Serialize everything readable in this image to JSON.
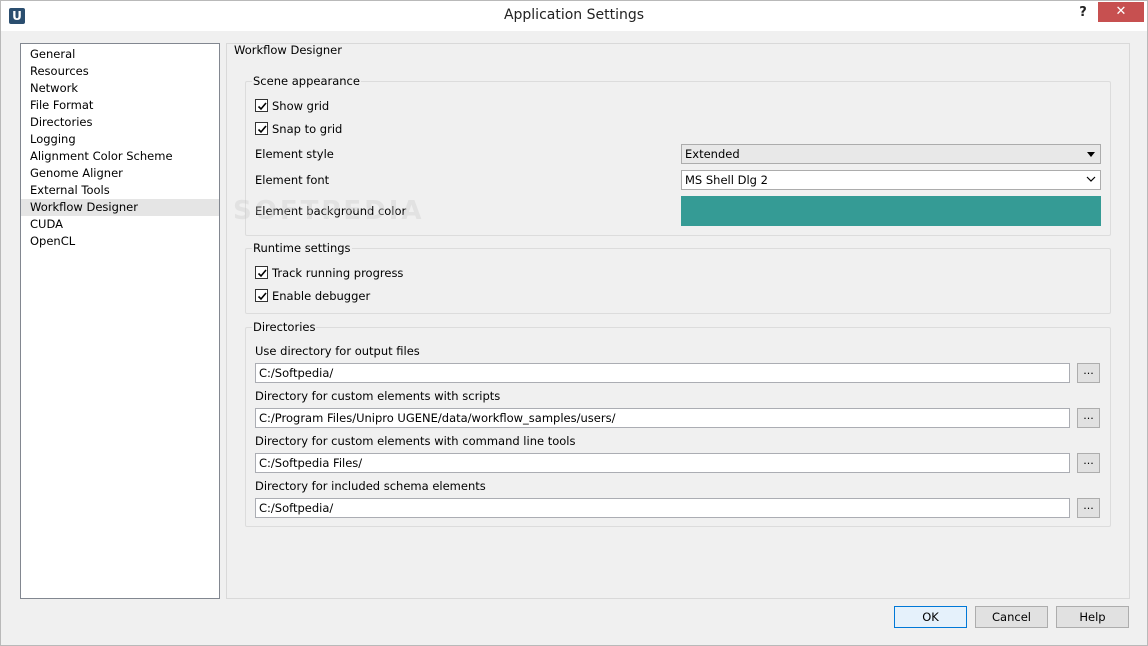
{
  "window": {
    "title": "Application Settings",
    "app_icon": "U",
    "help_label": "?",
    "close_label": "✕"
  },
  "nav": {
    "items": [
      {
        "label": "General"
      },
      {
        "label": "Resources"
      },
      {
        "label": "Network"
      },
      {
        "label": "File Format"
      },
      {
        "label": "Directories"
      },
      {
        "label": "Logging"
      },
      {
        "label": "Alignment Color Scheme"
      },
      {
        "label": "Genome Aligner"
      },
      {
        "label": "External Tools"
      },
      {
        "label": "Workflow Designer"
      },
      {
        "label": "CUDA"
      },
      {
        "label": "OpenCL"
      }
    ],
    "selected": "Workflow Designer"
  },
  "panel": {
    "title": "Workflow Designer",
    "scene": {
      "title": "Scene appearance",
      "show_grid": {
        "label": "Show grid",
        "checked": true
      },
      "snap_to_grid": {
        "label": "Snap to grid",
        "checked": true
      },
      "element_style_label": "Element style",
      "element_style_value": "Extended",
      "element_font_label": "Element font",
      "element_font_value": "MS Shell Dlg 2",
      "bg_color_label": "Element background color",
      "bg_color": "#359b95"
    },
    "runtime": {
      "title": "Runtime settings",
      "track_progress": {
        "label": "Track running progress",
        "checked": true
      },
      "enable_debugger": {
        "label": "Enable debugger",
        "checked": true
      }
    },
    "directories": {
      "title": "Directories",
      "output_label": "Use directory for output files",
      "output_value": "C:/Softpedia/",
      "scripts_label": "Directory for custom elements with scripts",
      "scripts_value": "C:/Program Files/Unipro UGENE/data/workflow_samples/users/",
      "cmdline_label": "Directory for custom elements with command line tools",
      "cmdline_value": "C:/Softpedia Files/",
      "schema_label": "Directory for included schema elements",
      "schema_value": "C:/Softpedia/",
      "browse_label": "..."
    }
  },
  "buttons": {
    "ok": "OK",
    "cancel": "Cancel",
    "help": "Help"
  },
  "watermark": "SOFTPEDIA"
}
